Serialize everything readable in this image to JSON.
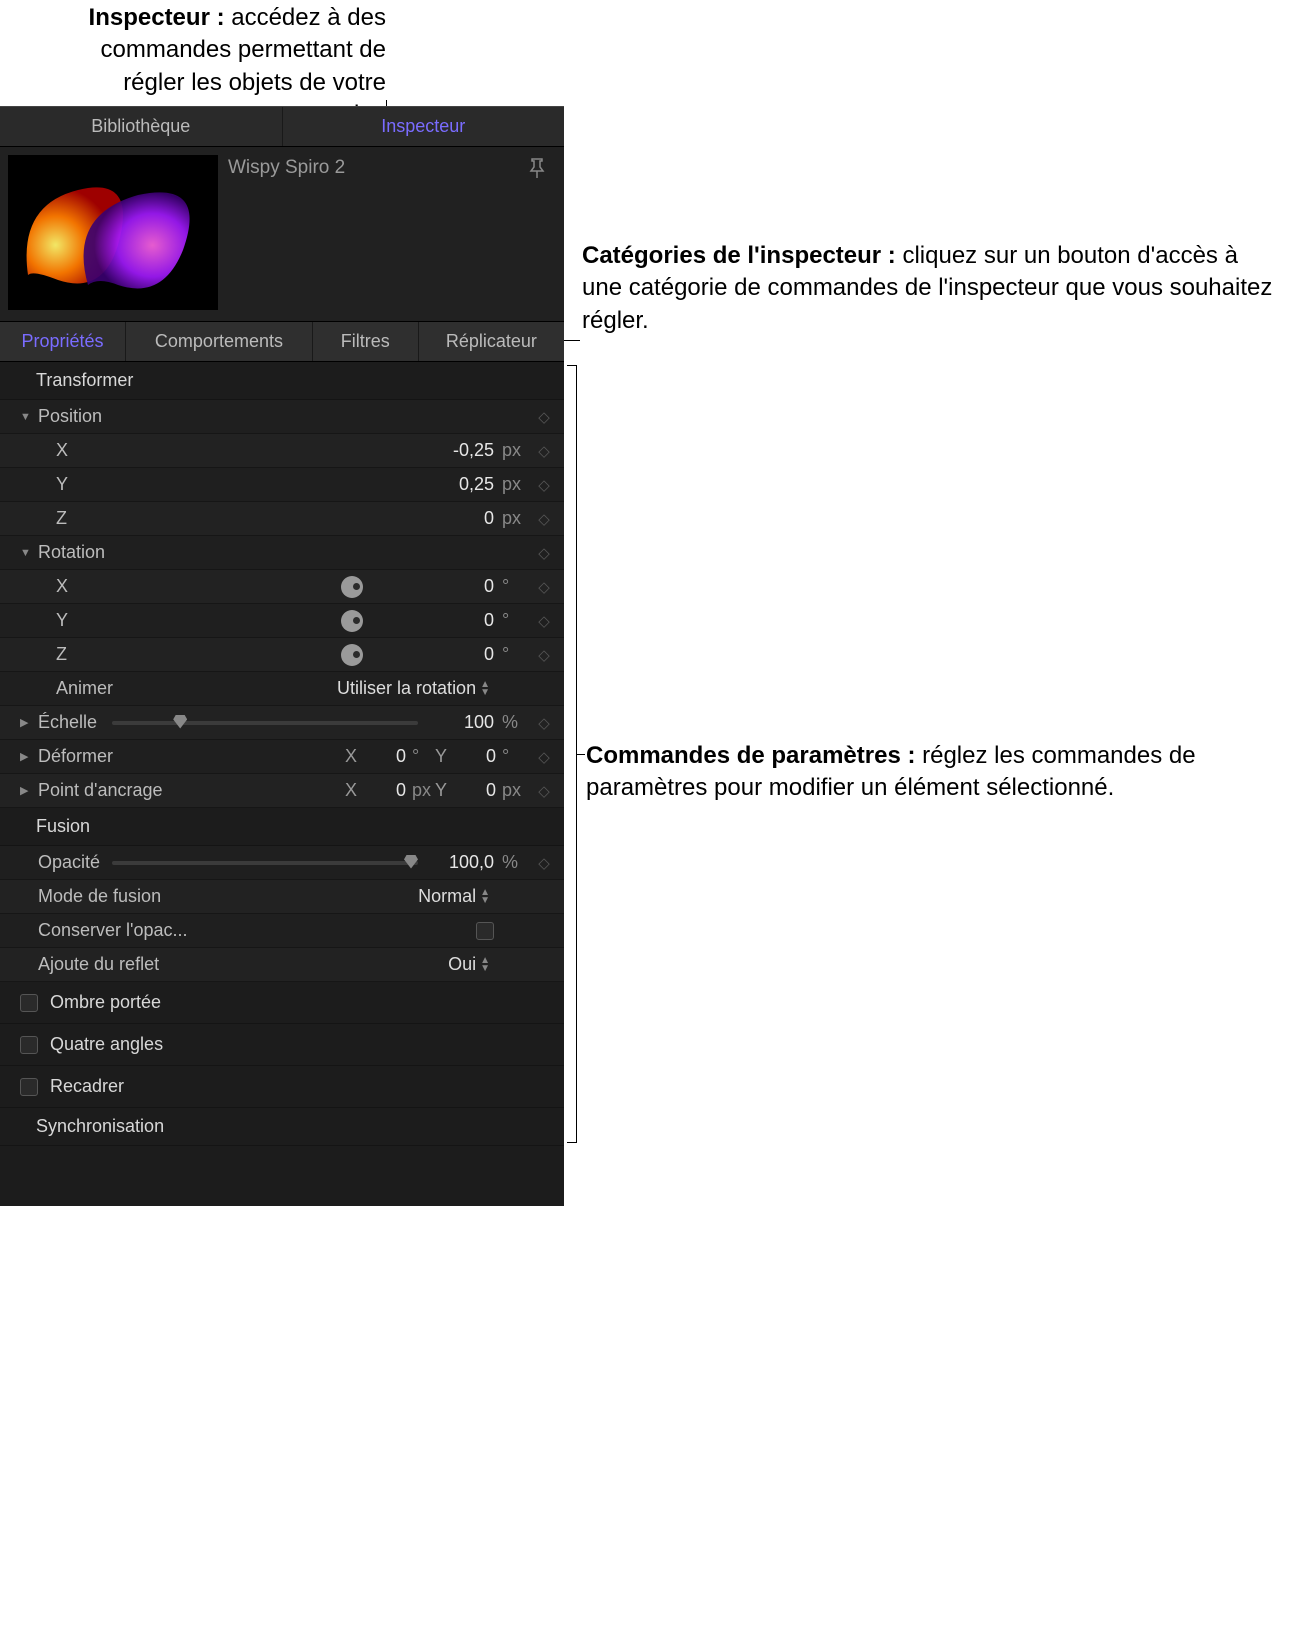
{
  "callouts": {
    "top": {
      "bold": "Inspecteur :",
      "text": " accédez à des commandes permettant de régler les objets de votre projet."
    },
    "cat": {
      "bold": "Catégories de l'inspecteur :",
      "text": " cliquez sur un bouton d'accès à une catégorie de commandes de l'inspecteur que vous souhaitez régler."
    },
    "params": {
      "bold": "Commandes de paramètres :",
      "text": " réglez les commandes de paramètres pour modifier un élément sélectionné."
    }
  },
  "topTabs": {
    "library": "Bibliothèque",
    "inspector": "Inspecteur"
  },
  "object": {
    "title": "Wispy Spiro 2"
  },
  "subTabs": {
    "properties": "Propriétés",
    "behaviors": "Comportements",
    "filters": "Filtres",
    "replicator": "Réplicateur"
  },
  "sections": {
    "transform": "Transformer",
    "position": "Position",
    "pos_x_label": "X",
    "pos_x_val": "-0,25",
    "pos_x_unit": "px",
    "pos_y_label": "Y",
    "pos_y_val": "0,25",
    "pos_y_unit": "px",
    "pos_z_label": "Z",
    "pos_z_val": "0",
    "pos_z_unit": "px",
    "rotation": "Rotation",
    "rot_x_label": "X",
    "rot_x_val": "0",
    "rot_x_unit": "°",
    "rot_y_label": "Y",
    "rot_y_val": "0",
    "rot_y_unit": "°",
    "rot_z_label": "Z",
    "rot_z_val": "0",
    "rot_z_unit": "°",
    "animate": "Animer",
    "animate_val": "Utiliser la rotation",
    "scale": "Échelle",
    "scale_val": "100",
    "scale_unit": "%",
    "shear": "Déformer",
    "shear_x_lbl": "X",
    "shear_x_val": "0",
    "shear_x_unit": "°",
    "shear_y_lbl": "Y",
    "shear_y_val": "0",
    "shear_y_unit": "°",
    "anchor": "Point d'ancrage",
    "anchor_x_lbl": "X",
    "anchor_x_val": "0",
    "anchor_x_unit": "px",
    "anchor_y_lbl": "Y",
    "anchor_y_val": "0",
    "anchor_y_unit": "px",
    "blend": "Fusion",
    "opacity": "Opacité",
    "opacity_val": "100,0",
    "opacity_unit": "%",
    "blend_mode": "Mode de fusion",
    "blend_mode_val": "Normal",
    "preserve": "Conserver l'opac...",
    "reflection": "Ajoute du reflet",
    "reflection_val": "Oui",
    "dropshadow": "Ombre portée",
    "fourcorner": "Quatre angles",
    "crop": "Recadrer",
    "timing": "Synchronisation"
  }
}
